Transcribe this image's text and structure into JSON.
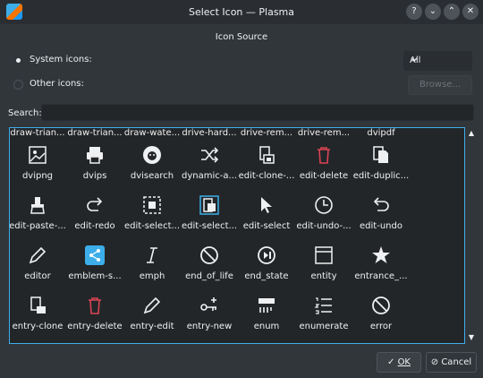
{
  "window": {
    "title": "Select Icon — Plasma",
    "buttons": {
      "help": "?",
      "minimize": "⌄",
      "maximize": "⌃",
      "close": "✕"
    }
  },
  "source": {
    "title": "Icon Source",
    "system_label": "System icons:",
    "other_label": "Other icons:",
    "category_value": "All",
    "browse_label": "Browse..."
  },
  "search": {
    "label": "Search:",
    "value": ""
  },
  "grid": {
    "top_labels": [
      "draw-trian...",
      "draw-trian...",
      "draw-wate...",
      "drive-hard...",
      "drive-rem...",
      "drive-rem...",
      "dvipdf"
    ],
    "rows": [
      [
        {
          "label": "dvipng",
          "icon": "image-icon"
        },
        {
          "label": "dvips",
          "icon": "printer-icon"
        },
        {
          "label": "dvisearch",
          "icon": "lion-icon"
        },
        {
          "label": "dynamic-a...",
          "icon": "shuffle-icon"
        },
        {
          "label": "edit-clone-...",
          "icon": "clone-icon"
        },
        {
          "label": "edit-delete",
          "icon": "trash-icon"
        },
        {
          "label": "edit-duplic...",
          "icon": "duplicate-icon"
        }
      ],
      [
        {
          "label": "edit-paste-...",
          "icon": "brush-icon"
        },
        {
          "label": "edit-redo",
          "icon": "redo-icon"
        },
        {
          "label": "edit-select...",
          "icon": "select-all-icon"
        },
        {
          "label": "edit-select...",
          "icon": "select-doc-icon"
        },
        {
          "label": "edit-select",
          "icon": "pointer-icon"
        },
        {
          "label": "edit-undo-...",
          "icon": "clock-icon"
        },
        {
          "label": "edit-undo",
          "icon": "undo-icon"
        }
      ],
      [
        {
          "label": "editor",
          "icon": "pencil-icon"
        },
        {
          "label": "emblem-s...",
          "icon": "share-icon"
        },
        {
          "label": "emph",
          "icon": "italic-icon"
        },
        {
          "label": "end_of_life",
          "icon": "forbidden-icon"
        },
        {
          "label": "end_state",
          "icon": "end-state-icon"
        },
        {
          "label": "entity",
          "icon": "entity-icon"
        },
        {
          "label": "entrance_...",
          "icon": "star-icon"
        }
      ],
      [
        {
          "label": "entry-clone",
          "icon": "entry-clone-icon"
        },
        {
          "label": "entry-delete",
          "icon": "trash-red-icon"
        },
        {
          "label": "entry-edit",
          "icon": "pencil-icon"
        },
        {
          "label": "entry-new",
          "icon": "key-plus-icon"
        },
        {
          "label": "enum",
          "icon": "enum-icon"
        },
        {
          "label": "enumerate",
          "icon": "list-numbered-icon"
        },
        {
          "label": "error",
          "icon": "forbidden-icon"
        }
      ]
    ],
    "partial_row_icons": [
      "chevron-right-icon",
      "chevron-left-icon",
      "frame-red-icon",
      "frame-blue-icon",
      "frame-red-icon",
      "frame-blue-icon",
      "doc-search-icon"
    ]
  },
  "footer": {
    "ok_label": "OK",
    "cancel_label": "Cancel"
  }
}
